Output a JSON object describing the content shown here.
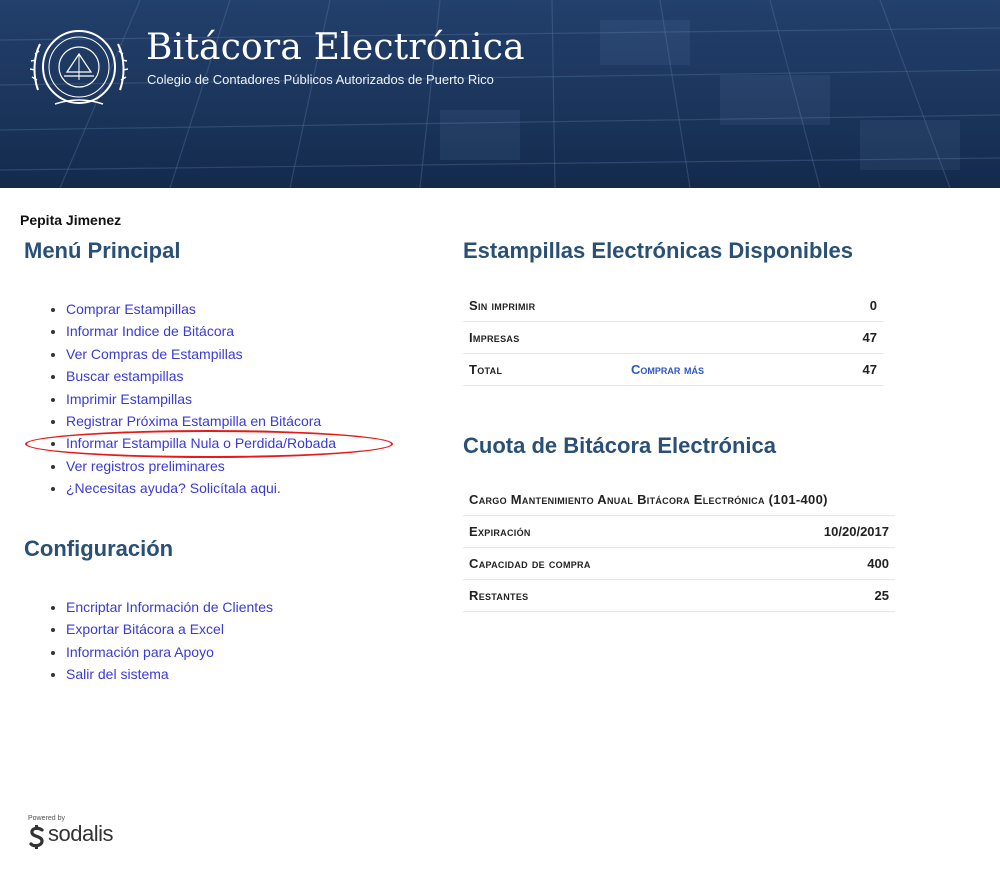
{
  "header": {
    "title": "Bitácora Electrónica",
    "subtitle": "Colegio de Contadores Públicos Autorizados de Puerto Rico",
    "logo_icon": "society-seal-icon"
  },
  "user": {
    "name": "Pepita Jimenez"
  },
  "main_menu": {
    "heading": "Menú Principal",
    "items": [
      {
        "label": "Comprar Estampillas"
      },
      {
        "label": "Informar Indice de Bitácora"
      },
      {
        "label": "Ver Compras de Estampillas"
      },
      {
        "label": "Buscar estampillas"
      },
      {
        "label": "Imprimir Estampillas"
      },
      {
        "label": "Registrar Próxima Estampilla en Bitácora"
      },
      {
        "label": "Informar Estampilla Nula o Perdida/Robada"
      },
      {
        "label": "Ver registros preliminares"
      },
      {
        "label": "¿Necesitas ayuda? Solicítala aqui."
      }
    ],
    "highlighted_item": "Informar Estampilla Nula o Perdida/Robada",
    "highlight_color": "#e51b1b"
  },
  "configuration": {
    "heading": "Configuración",
    "items": [
      {
        "label": "Encriptar Información de Clientes"
      },
      {
        "label": "Exportar Bitácora a Excel"
      },
      {
        "label": "Información para Apoyo"
      },
      {
        "label": "Salir del sistema"
      }
    ]
  },
  "stamps": {
    "heading": "Estampillas Electrónicas Disponibles",
    "rows": [
      {
        "label": "Sin imprimir",
        "link": "",
        "value": "0"
      },
      {
        "label": "Impresas",
        "link": "",
        "value": "47"
      },
      {
        "label": "Total",
        "link": "Comprar más",
        "value": "47"
      }
    ]
  },
  "quota": {
    "heading": "Cuota de Bitácora Electrónica",
    "plan": "Cargo Mantenimiento Anual Bitácora Electrónica (101-400)",
    "rows": [
      {
        "label": "Expiración",
        "value": "10/20/2017"
      },
      {
        "label": "Capacidad de compra",
        "value": "400"
      },
      {
        "label": "Restantes",
        "value": "25"
      }
    ]
  },
  "footer": {
    "powered_label": "Powered by",
    "brand": "sodalis",
    "brand_icon": "sodalis-logo-icon"
  },
  "colors": {
    "heading": "#2a5075",
    "link": "#3a3ad6",
    "banner": "#1d375f"
  }
}
